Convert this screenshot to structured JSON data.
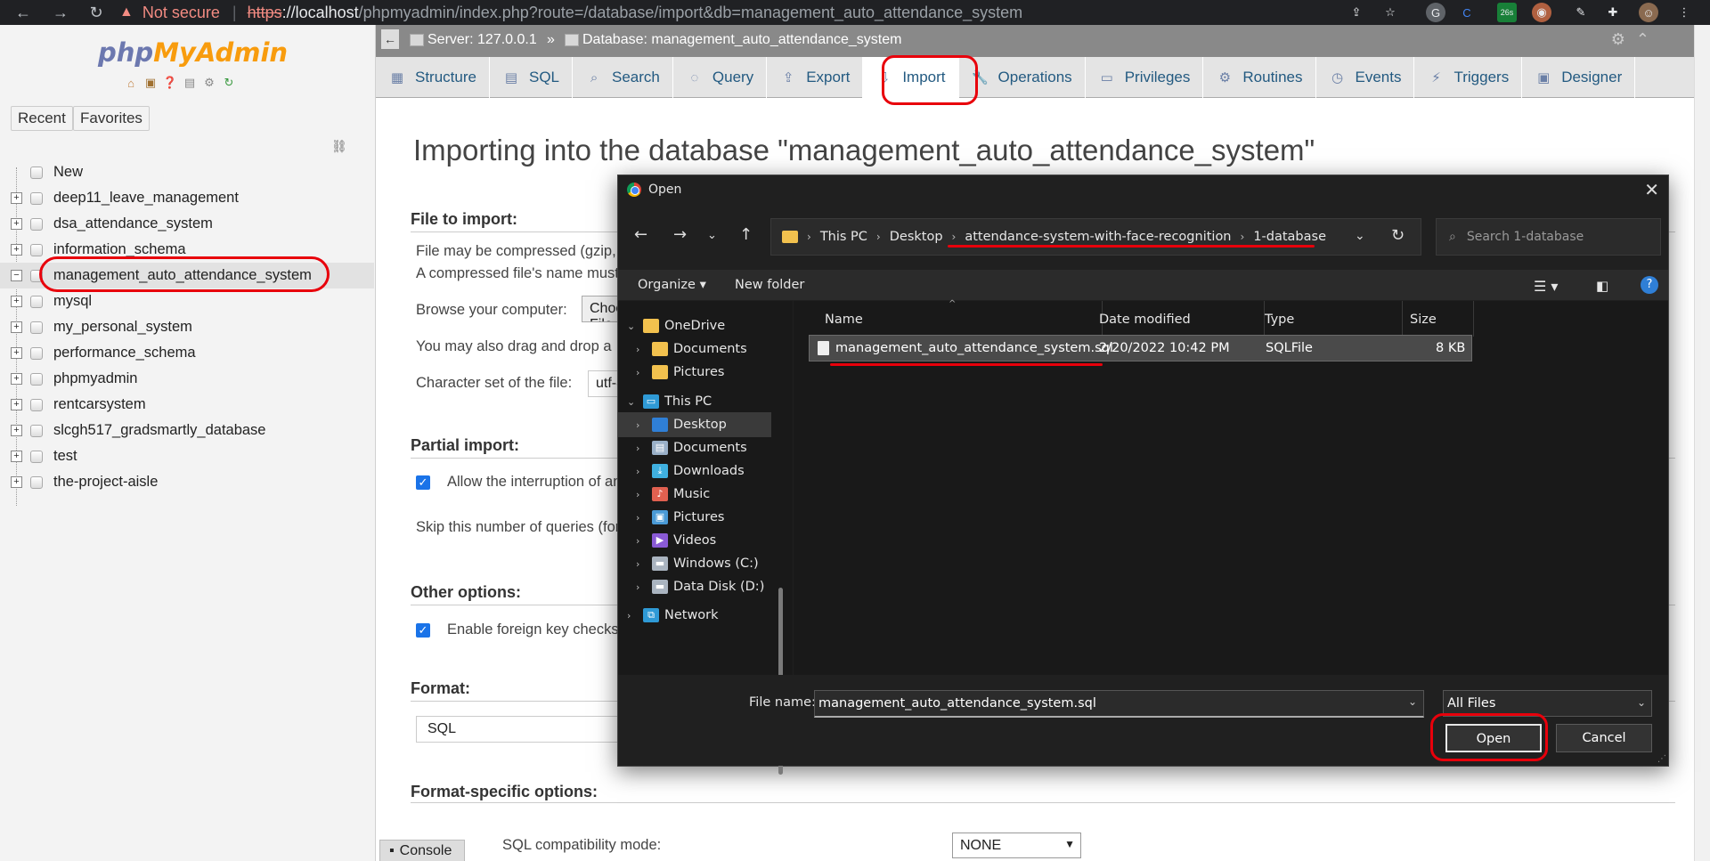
{
  "browser": {
    "back": "←",
    "forward": "→",
    "reload": "↻",
    "warning_icon": "▲",
    "not_secure": "Not secure",
    "separator": "|",
    "url_scheme": "https",
    "url_host": "://localhost",
    "url_path": "/phpmyadmin/index.php?route=/database/import&db=management_auto_attendance_system",
    "ext_badge": "26s"
  },
  "nav": {
    "logo_php": "php",
    "logo_myadmin": "MyAdmin",
    "tabs": [
      "Recent",
      "Favorites"
    ],
    "new_label": "New",
    "databases": [
      {
        "name": "deep11_leave_management",
        "expanded": false
      },
      {
        "name": "dsa_attendance_system",
        "expanded": false
      },
      {
        "name": "information_schema",
        "expanded": false
      },
      {
        "name": "management_auto_attendance_system",
        "expanded": true,
        "selected": true
      },
      {
        "name": "mysql",
        "expanded": false
      },
      {
        "name": "my_personal_system",
        "expanded": false
      },
      {
        "name": "performance_schema",
        "expanded": false
      },
      {
        "name": "phpmyadmin",
        "expanded": false
      },
      {
        "name": "rentcarsystem",
        "expanded": false
      },
      {
        "name": "slcgh517_gradsmartly_database",
        "expanded": false
      },
      {
        "name": "test",
        "expanded": false
      },
      {
        "name": "the-project-aisle",
        "expanded": false
      }
    ]
  },
  "breadcrumb": {
    "server": "Server: 127.0.0.1",
    "sep": "»",
    "database": "Database: management_auto_attendance_system"
  },
  "menu": {
    "tabs": [
      "Structure",
      "SQL",
      "Search",
      "Query",
      "Export",
      "Import",
      "Operations",
      "Privileges",
      "Routines",
      "Events",
      "Triggers",
      "Designer"
    ],
    "active": "Import"
  },
  "main": {
    "title": "Importing into the database \"management_auto_attendance_system\"",
    "file_to_import": "File to import:",
    "compressed_line1": "File may be compressed (gzip,",
    "compressed_line2": "A compressed file's name must",
    "browse_label": "Browse your computer:",
    "choose_btn": "Choose File",
    "drag_text": "You may also drag and drop a",
    "charset_label": "Character set of the file:",
    "charset_value": "utf-8",
    "partial_import": "Partial import:",
    "allow_interrupt": "Allow the interruption of an",
    "skip_queries": "Skip this number of queries (for",
    "other_options": "Other options:",
    "foreign_keys": "Enable foreign key checks",
    "format": "Format:",
    "format_value": "SQL",
    "format_specific": "Format-specific options:",
    "sql_compat": "SQL compatibility mode:",
    "sql_compat_value": "NONE",
    "console": "Console"
  },
  "dialog": {
    "title": "Open",
    "close": "✕",
    "path": [
      "This PC",
      "Desktop",
      "attendance-system-with-face-recognition",
      "1-database"
    ],
    "search_placeholder": "Search 1-database",
    "organize": "Organize ▾",
    "new_folder": "New folder",
    "help": "?",
    "sidebar": [
      {
        "label": "OneDrive",
        "level": 0,
        "expanded": true,
        "icon": "folder",
        "color": "#f2c14e"
      },
      {
        "label": "Documents",
        "level": 1,
        "icon": "folder",
        "color": "#f2c14e"
      },
      {
        "label": "Pictures",
        "level": 1,
        "icon": "folder",
        "color": "#f2c14e"
      },
      {
        "label": "This PC",
        "level": 0,
        "expanded": true,
        "icon": "monitor",
        "color": "#2f9ad6"
      },
      {
        "label": "Desktop",
        "level": 1,
        "icon": "desktop",
        "color": "#2f7fd6",
        "selected": true
      },
      {
        "label": "Documents",
        "level": 1,
        "icon": "document",
        "color": "#9ab0c8"
      },
      {
        "label": "Downloads",
        "level": 1,
        "icon": "download",
        "color": "#3fb0e0"
      },
      {
        "label": "Music",
        "level": 1,
        "icon": "music",
        "color": "#e06050"
      },
      {
        "label": "Pictures",
        "level": 1,
        "icon": "pictures",
        "color": "#4a9ad6"
      },
      {
        "label": "Videos",
        "level": 1,
        "icon": "video",
        "color": "#8a5ad6"
      },
      {
        "label": "Windows (C:)",
        "level": 1,
        "icon": "drive",
        "color": "#aab4c0"
      },
      {
        "label": "Data Disk (D:)",
        "level": 1,
        "icon": "drive",
        "color": "#aab4c0"
      },
      {
        "label": "Network",
        "level": 0,
        "icon": "network",
        "color": "#2f9ad6"
      }
    ],
    "columns": [
      "Name",
      "Date modified",
      "Type",
      "Size"
    ],
    "files": [
      {
        "name": "management_auto_attendance_system.sql",
        "date": "2/20/2022 10:42 PM",
        "type": "SQLFile",
        "size": "8 KB"
      }
    ],
    "filename_label": "File name:",
    "filename_value": "management_auto_attendance_system.sql",
    "filetype_value": "All Files",
    "open_btn": "Open",
    "cancel_btn": "Cancel"
  },
  "colors": {
    "annotation": "#e8000b",
    "pma_blue": "#6c78af",
    "pma_orange": "#f89c0e",
    "link": "#235a81"
  }
}
